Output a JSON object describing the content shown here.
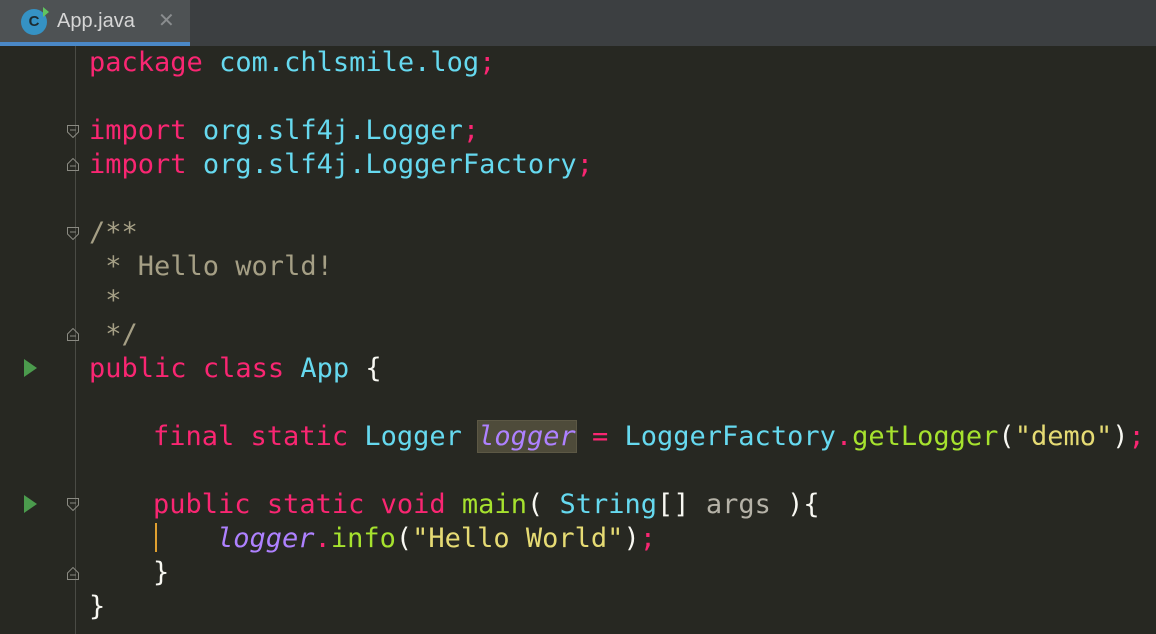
{
  "tab": {
    "icon_letter": "C",
    "file_name": "App.java",
    "close_glyph": "✕"
  },
  "code": {
    "l1": {
      "kw": "package",
      "pkg": "com.chlsmile.log",
      "semi": ";"
    },
    "l3": {
      "kw": "import",
      "pkg": "org.slf4j.Logger",
      "semi": ";"
    },
    "l4": {
      "kw": "import",
      "pkg": "org.slf4j.LoggerFactory",
      "semi": ";"
    },
    "l6": {
      "text": "/**"
    },
    "l7": {
      "text": " * Hello world!"
    },
    "l8": {
      "text": " *"
    },
    "l9": {
      "text": " */"
    },
    "l10": {
      "kw1": "public",
      "kw2": "class",
      "name": "App",
      "brace": "{"
    },
    "l12": {
      "kw1": "final",
      "kw2": "static",
      "type": "Logger",
      "field": "logger",
      "eq": "=",
      "factory": "LoggerFactory",
      "dot": ".",
      "method": "getLogger",
      "open": "(",
      "str": "\"demo\"",
      "close": ")",
      "semi": ";"
    },
    "l14": {
      "kw1": "public",
      "kw2": "static",
      "kw3": "void",
      "method": "main",
      "open": "(",
      "type": "String",
      "arr": "[]",
      "arg": "args",
      "close": "){"
    },
    "l15": {
      "field": "logger",
      "dot": ".",
      "method": "info",
      "open": "(",
      "str": "\"Hello World\"",
      "close": ")",
      "semi": ";"
    },
    "l16": {
      "text": "}"
    },
    "l17": {
      "text": "}"
    }
  }
}
